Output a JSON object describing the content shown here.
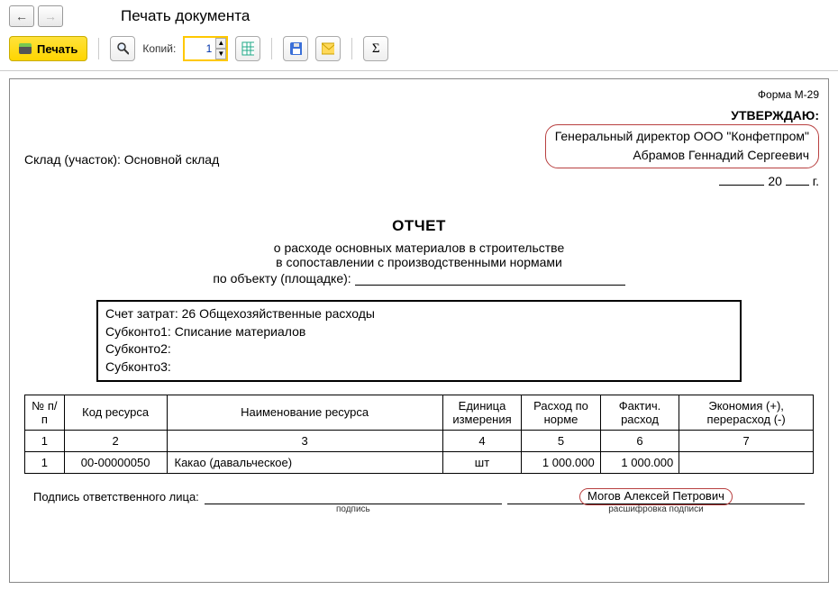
{
  "header": {
    "title": "Печать документа"
  },
  "toolbar": {
    "print_label": "Печать",
    "copies_label": "Копий:",
    "copies_value": "1"
  },
  "doc": {
    "form_code": "Форма М-29",
    "warehouse_label": "Склад (участок): ",
    "warehouse_value": "Основной склад",
    "approve": {
      "title": "УТВЕРЖДАЮ:",
      "line1": "Генеральный директор ООО \"Конфетпром\"",
      "line2": "Абрамов Геннадий Сергеевич",
      "year_prefix": "20",
      "year_suffix": "г."
    },
    "report": {
      "title": "ОТЧЕТ",
      "sub1": "о расходе основных материалов в строительстве",
      "sub2": "в сопоставлении с производственными нормами",
      "sub3": "по объекту (площадке):"
    },
    "costbox": {
      "l1": "Счет затрат: 26 Общехозяйственные расходы",
      "l2": "Субконто1: Списание материалов",
      "l3": "Субконто2:",
      "l4": "Субконто3:"
    },
    "table": {
      "headers": [
        "№ п/п",
        "Код ресурса",
        "Наименование ресурса",
        "Единица измерения",
        "Расход по норме",
        "Фактич. расход",
        "Экономия (+), перерасход (-)"
      ],
      "colnums": [
        "1",
        "2",
        "3",
        "4",
        "5",
        "6",
        "7"
      ],
      "rows": [
        {
          "n": "1",
          "code": "00-00000050",
          "name": "Какао (давальческое)",
          "unit": "шт",
          "norm": "1 000.000",
          "fact": "1 000.000",
          "econ": ""
        }
      ]
    },
    "signature": {
      "label": "Подпись ответственного лица:",
      "cap1": "подпись",
      "name": "Могов Алексей Петрович",
      "cap2": "расшифровка подписи"
    }
  }
}
